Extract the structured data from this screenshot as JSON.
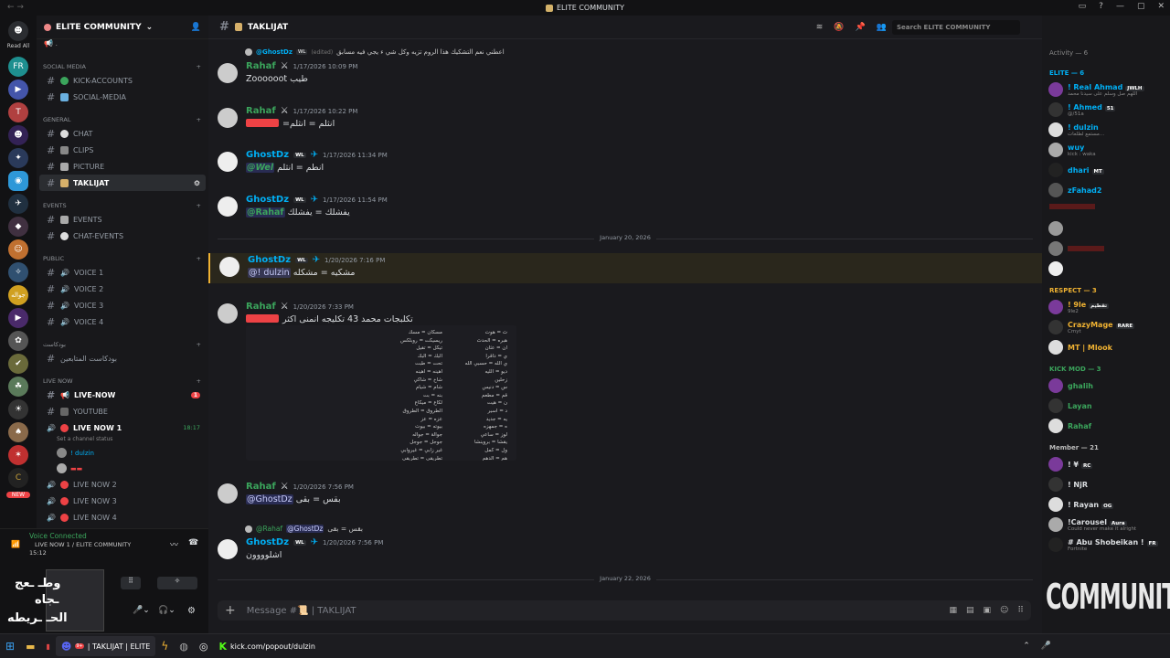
{
  "window": {
    "title": "ELITE COMMUNITY"
  },
  "servers": {
    "read_all": "Read All",
    "new_badge": "NEW"
  },
  "sidebar": {
    "server_name": "ELITE COMMUNITY",
    "categories": {
      "social_media": "SOCIAL MEDIA",
      "general": "GENERAL",
      "events": "EVENTS",
      "public": "PUBLIC",
      "broadcast": "بودكاست",
      "live_now": "LIVE NOW"
    },
    "channels": {
      "kick_accounts": "KICK-ACCOUNTS",
      "social_media": "SOCIAL-MEDIA",
      "chat": "CHAT",
      "clips": "CLIPS",
      "picture": "PICTURE",
      "taklijat": "TAKLIJAT",
      "events": "EVENTS",
      "chat_events": "CHAT-EVENTS",
      "voice1": "VOICE 1",
      "voice2": "VOICE 2",
      "voice3": "VOICE 3",
      "voice4": "VOICE 4",
      "broadcast_followers": "بودكاست المتابعين",
      "live_now": "LIVE-NOW",
      "youtube": "YOUTUBE",
      "live_now_1": "LIVE NOW 1",
      "live_now_1_time": "18:17",
      "channel_status": "Set a channel status",
      "vc_user": "! dulzin",
      "live_now_2": "LIVE NOW 2",
      "live_now_3": "LIVE NOW 3",
      "live_now_4": "LIVE NOW 4"
    },
    "live_badge": "1"
  },
  "voice": {
    "status": "Voice Connected",
    "location": "LIVE NOW 1 / ELITE COMMUNITY",
    "time": "15:12"
  },
  "overlay": {
    "line1": "وطـ  ـعج",
    "line2": "ـجاه",
    "line3": "الحـ  ـريطه"
  },
  "header": {
    "channel": "TAKLIJAT",
    "search_placeholder": "Search ELITE COMMUNITY"
  },
  "messages": {
    "reply0": {
      "name": "@GhostDz",
      "text": "اعطني نعم التشكيك هذا الروم تزيه وكل شي ء يجي فيه مسابق",
      "edited": "(edited)"
    },
    "m1": {
      "author": "Rahaf",
      "time": "1/17/2026 10:09 PM",
      "text": "Zoooooot طيب"
    },
    "m2": {
      "author": "Rahaf",
      "time": "1/17/2026 10:22 PM",
      "text": "=انثلم = انثلم"
    },
    "m3": {
      "author": "GhostDz",
      "time": "1/17/2026 11:34 PM",
      "mention": "@Wel",
      "text": "انطم = انثلم"
    },
    "m4": {
      "author": "GhostDz",
      "time": "1/17/2026 11:54 PM",
      "mention": "@Rahaf",
      "text": "يفشلك = يفشلك"
    },
    "date1": "January 20, 2026",
    "m5": {
      "author": "GhostDz",
      "time": "1/20/2026 7:16 PM",
      "mention": "@! dulzin",
      "text": "مشكيه = مشكله"
    },
    "m6": {
      "author": "Rahaf",
      "time": "1/20/2026 7:33 PM",
      "text": "تكلبجات محمد 43 تكليجه انمنى اكثر"
    },
    "img_left": [
      "مسكان = مسك",
      "ريسيكت = روبلكس",
      "تيكل = تقيل",
      "البك = البك",
      "تحت = طبت",
      "اهينه = اهينه",
      "شاخ = شاكي",
      "شام = شيام",
      "بنه = بت",
      "لكاع = ميكاع",
      "الطروق = الطروق",
      "عزه = عز",
      "بيوته = بيوت",
      "جوالة = جواله",
      "جوجل = جوجل",
      "غير زابي = غيروابي",
      "تطريقي = تطريقي"
    ],
    "img_right": [
      "ث = هوت",
      "هبره = الحدث",
      "ان = عثان",
      "ي = داقرا",
      "ي الله = حسبي الله",
      "ديو = الليه",
      "زحلين",
      "س = دنيس",
      "قم = مطعم",
      "ن = هيت",
      "د = اسير",
      "يه = جديد",
      "ه = جمهزه",
      "لوز = ساعي",
      "يقشا = بروينشا",
      "ول = كمل",
      "هم = الدهم"
    ],
    "m7": {
      "author": "Rahaf",
      "time": "1/20/2026 7:56 PM",
      "mention": "@GhostDz",
      "text": "بقس = بقى"
    },
    "reply8": {
      "name": "@Rahaf",
      "mention": "@GhostDz",
      "text": "بقس = بقى"
    },
    "m8": {
      "author": "GhostDz",
      "time": "1/20/2026 7:56 PM",
      "text": "اشلوووون"
    },
    "date2": "January 22, 2026",
    "tag_wl": "WL"
  },
  "composer": {
    "placeholder": "Message #📜 | TAKLIJAT"
  },
  "members": {
    "activity": "Activity — 6",
    "elite": "ELITE — 6",
    "elite_list": [
      {
        "name": "! Real Ahmad",
        "tag": "JWLH",
        "sub": "اللهم صل وسلم على سيدنا محمد"
      },
      {
        "name": "! Ahmed",
        "tag": "51",
        "sub": "@/51a"
      },
      {
        "name": "! dulzin",
        "sub": "مستمع لطلعات..."
      },
      {
        "name": "wuy",
        "sub": "kick : waka"
      },
      {
        "name": "dhari",
        "tag": "MT"
      },
      {
        "name": "zFahad2"
      }
    ],
    "respect": "RESPECT — 3",
    "respect_list": [
      {
        "name": "! 9le",
        "tag": "تقطيم",
        "sub": "9le2"
      },
      {
        "name": "CrazyMage",
        "tag": "RARE",
        "sub": "Cmyt"
      },
      {
        "name": "MT | Mlook"
      }
    ],
    "kickmod": "KICK MOD — 3",
    "kickmod_list": [
      {
        "name": "ghalih"
      },
      {
        "name": "Layan"
      },
      {
        "name": "Rahaf"
      }
    ],
    "member": "Member — 21",
    "member_list": [
      {
        "name": "! ¥",
        "tag": "RC"
      },
      {
        "name": "! NjR"
      },
      {
        "name": "! Rayan",
        "tag": "OG"
      },
      {
        "name": "!Carousel",
        "tag": "Aura",
        "sub": "Could never make it alright"
      },
      {
        "name": "# Abu Shobeikan !",
        "tag": "FR",
        "sub": "Fortnite"
      }
    ],
    "watermark": "COMMUNITY"
  },
  "taskbar": {
    "discord": "| TAKLIJAT | ELITE",
    "kick": "kick.com/popout/dulzin",
    "discord_badge": "9+"
  },
  "colors": {
    "green": "#3ba55c",
    "blue": "#00aff4",
    "teal": "#4fd1c5",
    "yellow": "#f0b232",
    "red": "#ed4245"
  }
}
